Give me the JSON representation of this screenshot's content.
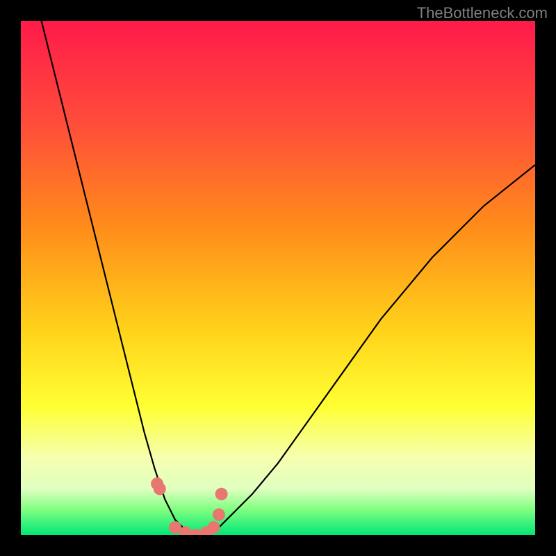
{
  "watermark": "TheBottleneck.com",
  "chart_data": {
    "type": "line",
    "title": "",
    "xlabel": "",
    "ylabel": "",
    "xlim": [
      0,
      100
    ],
    "ylim": [
      0,
      100
    ],
    "series": [
      {
        "name": "bottleneck-curve",
        "x": [
          4,
          6,
          8,
          10,
          12,
          14,
          16,
          18,
          20,
          22,
          24,
          26,
          28,
          30,
          32,
          34,
          36,
          38,
          40,
          45,
          50,
          55,
          60,
          65,
          70,
          75,
          80,
          85,
          90,
          95,
          100
        ],
        "y": [
          100,
          92,
          84,
          76,
          68,
          60,
          52,
          44,
          36,
          28,
          20,
          13,
          7,
          3,
          1,
          0,
          0,
          1,
          3,
          8,
          14,
          21,
          28,
          35,
          42,
          48,
          54,
          59,
          64,
          68,
          72
        ]
      }
    ],
    "markers": {
      "name": "highlight-points",
      "color": "#e8786f",
      "x": [
        26.5,
        27,
        30,
        32,
        34,
        36,
        37.5,
        38.5,
        39
      ],
      "y": [
        10,
        9,
        1.5,
        0.5,
        0,
        0.5,
        1.5,
        4,
        8
      ]
    },
    "background": {
      "type": "vertical-gradient",
      "stops": [
        {
          "pos": 0,
          "color": "#ff1a4a"
        },
        {
          "pos": 20,
          "color": "#ff4d3a"
        },
        {
          "pos": 40,
          "color": "#ff8c1a"
        },
        {
          "pos": 60,
          "color": "#ffd21a"
        },
        {
          "pos": 75,
          "color": "#ffff33"
        },
        {
          "pos": 85,
          "color": "#f5ffb0"
        },
        {
          "pos": 91,
          "color": "#e0ffc0"
        },
        {
          "pos": 95,
          "color": "#80ff80"
        },
        {
          "pos": 100,
          "color": "#00e676"
        }
      ]
    }
  }
}
